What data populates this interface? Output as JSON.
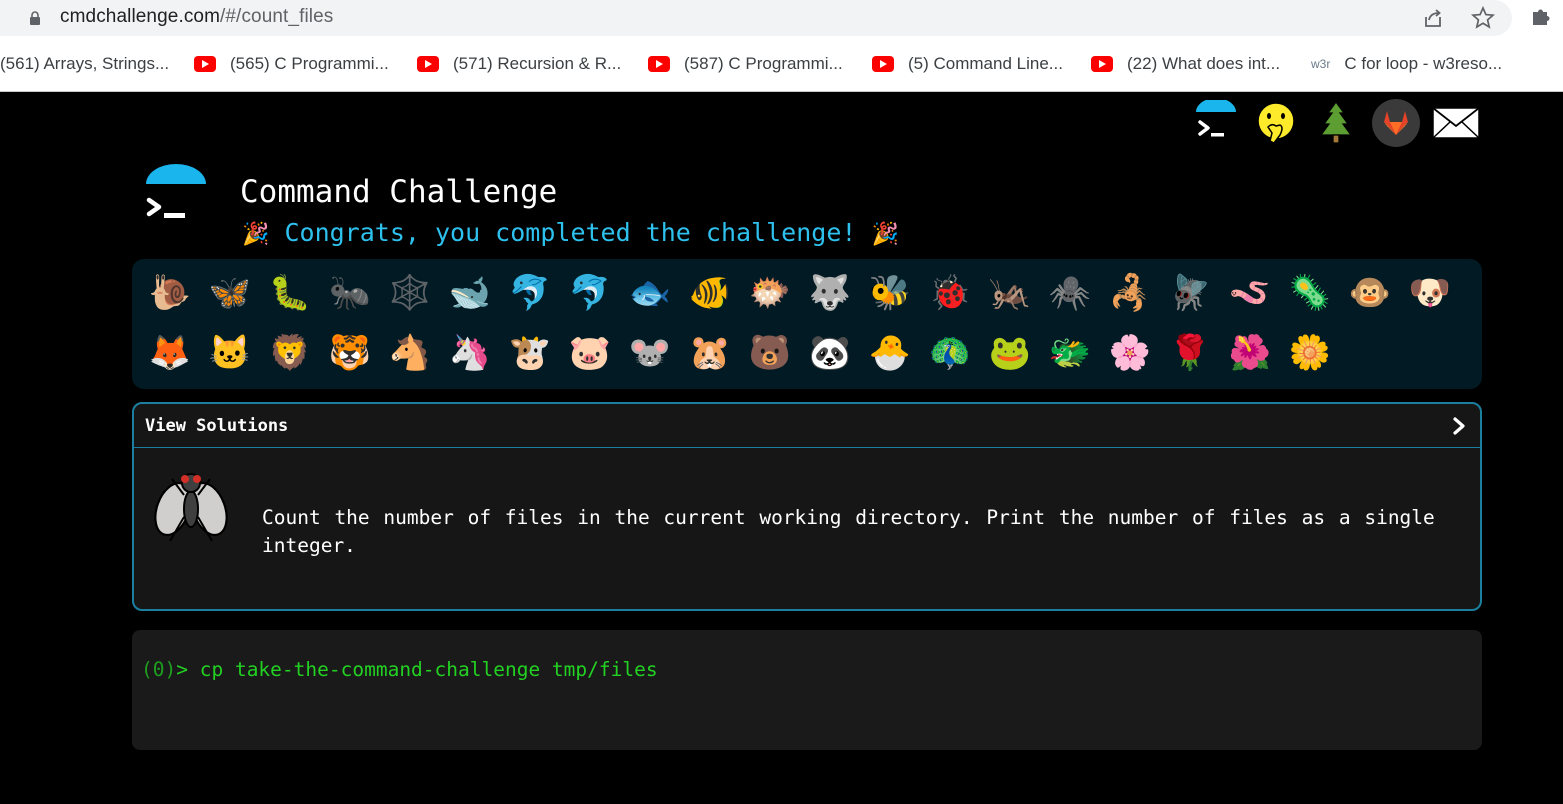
{
  "browser": {
    "url_host": "cmdchallenge.com",
    "url_path": "/#/count_files",
    "bookmarks": [
      {
        "label": "(561) Arrays, Strings...",
        "icon": "none"
      },
      {
        "label": "(565) C Programmi...",
        "icon": "youtube-icon"
      },
      {
        "label": "(571) Recursion & R...",
        "icon": "youtube-icon"
      },
      {
        "label": "(587) C Programmi...",
        "icon": "youtube-icon"
      },
      {
        "label": "(5) Command Line...",
        "icon": "youtube-icon"
      },
      {
        "label": "(22) What does int...",
        "icon": "youtube-icon"
      },
      {
        "label": "C for loop - w3reso...",
        "icon": "w3r-icon",
        "icon_text": "w3r"
      }
    ]
  },
  "site": {
    "title": "Command Challenge",
    "congrats": "Congrats, you completed the challenge!",
    "party_emoji": "🎉",
    "top_icons": [
      "terminal-logo-icon",
      "face-with-hand-over-mouth-icon",
      "tree-icon",
      "gitlab-icon",
      "mail-icon"
    ]
  },
  "animals": {
    "row1": [
      "🐌",
      "🦋",
      "🐛",
      "🐜",
      "🕸️",
      "🐋",
      "🐬",
      "🐬",
      "🐟",
      "🐠",
      "🐡",
      "🐺",
      "🐝",
      "🐞",
      "🦗",
      "🕷️",
      "🦂",
      "🪰",
      "🪱",
      "🦠",
      "🐵",
      "🐶"
    ],
    "row2": [
      "🦊",
      "🐱",
      "🦁",
      "🐯",
      "🐴",
      "🦄",
      "🐮",
      "🐷",
      "🐭",
      "🐹",
      "🐻",
      "🐼",
      "🐣",
      "🦚",
      "🐸",
      "🐲",
      "🌸",
      "🌹",
      "🌺",
      "🌼"
    ]
  },
  "solution": {
    "header": "View Solutions",
    "task": "Count the number of files in the current working directory. Print the number of files as a single integer."
  },
  "terminal": {
    "status": "(0)",
    "prompt": ">",
    "command": "cp take-the-command-challenge tmp/files"
  },
  "colors": {
    "accent": "#2ec1ee",
    "border": "#1b7fa0",
    "terminal_text": "#22d122",
    "animal_panel": "#011a24"
  }
}
